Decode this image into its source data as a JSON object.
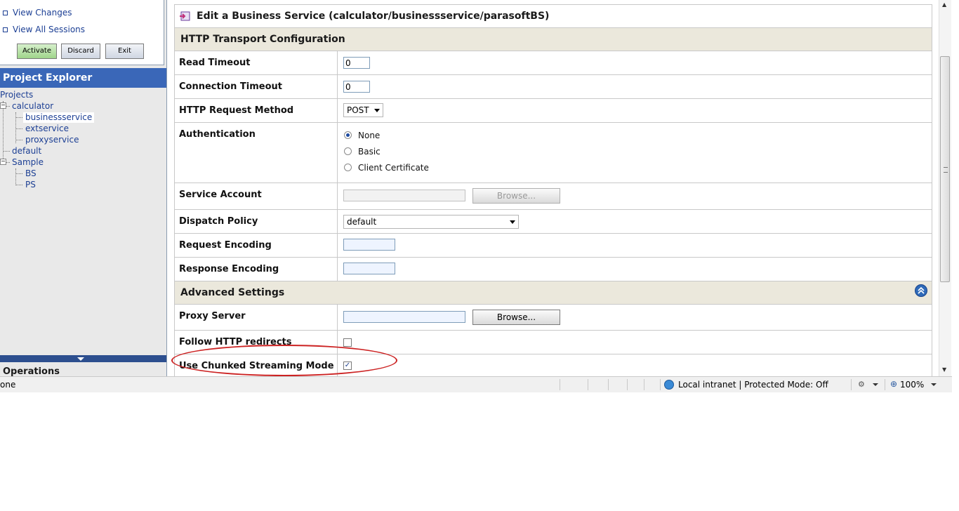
{
  "session": {
    "links": [
      "View Changes",
      "View All Sessions"
    ],
    "buttons": {
      "activate": "Activate",
      "discard": "Discard",
      "exit": "Exit"
    }
  },
  "project_explorer": {
    "title": "Project Explorer",
    "root": "Projects",
    "tree": {
      "calculator": "calculator",
      "businessservice": "businessservice",
      "extservice": "extservice",
      "proxyservice": "proxyservice",
      "default": "default",
      "sample": "Sample",
      "bs": "BS",
      "ps": "PS"
    }
  },
  "operations": {
    "title": "Operations"
  },
  "page": {
    "title": "Edit a Business Service (calculator/businessservice/parasoftBS)"
  },
  "sections": {
    "http_transport": "HTTP Transport Configuration",
    "advanced": "Advanced Settings"
  },
  "fields": {
    "read_timeout": {
      "label": "Read Timeout",
      "value": "0"
    },
    "connection_timeout": {
      "label": "Connection Timeout",
      "value": "0"
    },
    "http_method": {
      "label": "HTTP Request Method",
      "value": "POST"
    },
    "authentication": {
      "label": "Authentication",
      "options": [
        "None",
        "Basic",
        "Client Certificate"
      ],
      "selected": "None"
    },
    "service_account": {
      "label": "Service Account",
      "value": "",
      "browse": "Browse..."
    },
    "dispatch_policy": {
      "label": "Dispatch Policy",
      "value": "default"
    },
    "request_encoding": {
      "label": "Request Encoding",
      "value": ""
    },
    "response_encoding": {
      "label": "Response Encoding",
      "value": ""
    },
    "proxy_server": {
      "label": "Proxy Server",
      "value": "",
      "browse": "Browse..."
    },
    "follow_redirects": {
      "label": "Follow HTTP redirects",
      "checked": false
    },
    "chunked_streaming": {
      "label": "Use Chunked Streaming Mode",
      "checked": true
    }
  },
  "statusbar": {
    "left": "one",
    "zone": "Local intranet | Protected Mode: Off",
    "zoom": "100%"
  },
  "colors": {
    "accent": "#3a67b8",
    "section_bg": "#ebe8dc",
    "annotation": "#cc2222",
    "link": "#1c3f94"
  }
}
